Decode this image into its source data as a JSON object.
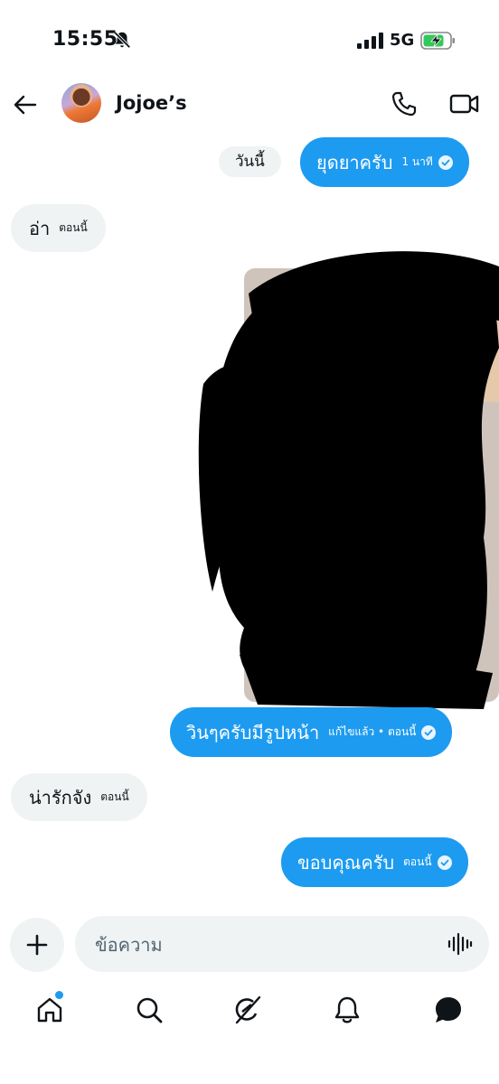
{
  "status_bar": {
    "time": "15:55",
    "network": "5G",
    "icons": [
      "bell-off-icon",
      "signal-icon",
      "battery-charging-icon"
    ]
  },
  "header": {
    "contact_name": "Jojoe’s",
    "icons": [
      "back-arrow-icon",
      "phone-icon",
      "video-call-icon"
    ]
  },
  "date_chip": "วันนี้",
  "messages": [
    {
      "direction": "outgoing",
      "text": "ยุดยาครับ",
      "meta": "1 นาที",
      "status": "sent"
    },
    {
      "direction": "incoming",
      "text": "อ่า",
      "meta": "ตอนนี้"
    },
    {
      "direction": "outgoing",
      "type": "image",
      "redacted": true
    },
    {
      "direction": "outgoing",
      "text": "วินๆครับมีรูปหน้า",
      "meta": "แก้ไขแล้ว • ตอนนี้",
      "status": "sent"
    },
    {
      "direction": "incoming",
      "text": "น่ารักจัง",
      "meta": "ตอนนี้"
    },
    {
      "direction": "outgoing",
      "text": "ขอบคุณครับ",
      "meta": "ตอนนี้",
      "status": "sent"
    }
  ],
  "composer": {
    "placeholder": "ข้อความ",
    "value": ""
  },
  "bottom_nav": {
    "items": [
      "home-icon",
      "search-icon",
      "grok-icon",
      "notifications-icon",
      "messages-icon"
    ],
    "active": "messages-icon",
    "home_has_badge": true
  },
  "colors": {
    "accent": "#1d9bf0",
    "incoming_bubble": "#eff3f4",
    "text": "#0f1419",
    "placeholder": "#536471"
  }
}
